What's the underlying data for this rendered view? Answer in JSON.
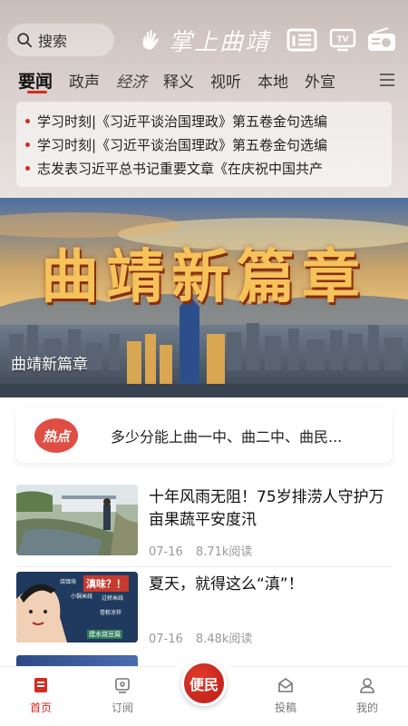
{
  "header": {
    "search_label": "搜索",
    "logo_text": "掌上曲靖"
  },
  "tabs": [
    {
      "label": "要闻",
      "active": true
    },
    {
      "label": "政声"
    },
    {
      "label": "经济"
    },
    {
      "label": "释义"
    },
    {
      "label": "视听"
    },
    {
      "label": "本地"
    },
    {
      "label": "外宣"
    }
  ],
  "headlines": [
    "学习时刻|《习近平谈治国理政》第五卷金句选编",
    "学习时刻|《习近平谈治国理政》第五卷金句选编",
    "志发表习近平总书记重要文章《在庆祝中国共产"
  ],
  "banner": {
    "title_art": "曲靖新篇章",
    "caption": "曲靖新篇章"
  },
  "hot": {
    "badge": "热点",
    "text": "多少分能上曲一中、曲二中、曲民..."
  },
  "articles": [
    {
      "title": "十年风雨无阻！75岁排涝人守护万亩果蔬平安度汛",
      "date": "07-16",
      "reads": "8.71k阅读"
    },
    {
      "title": "夏天，就得这么“滇”！",
      "date": "07-16",
      "reads": "8.48k阅读"
    }
  ],
  "thumb2": {
    "tag": "滇味？！",
    "items": [
      "烧饵块",
      "小锅米线",
      "过桥米线",
      "卷粉凉拌",
      "建水烧豆腐"
    ]
  },
  "bottom_nav": {
    "home": "首页",
    "subscribe": "订阅",
    "center": "便民",
    "submit": "投稿",
    "mine": "我的"
  },
  "colors": {
    "accent": "#d62b1f",
    "hot_badge": "#e04e43"
  }
}
